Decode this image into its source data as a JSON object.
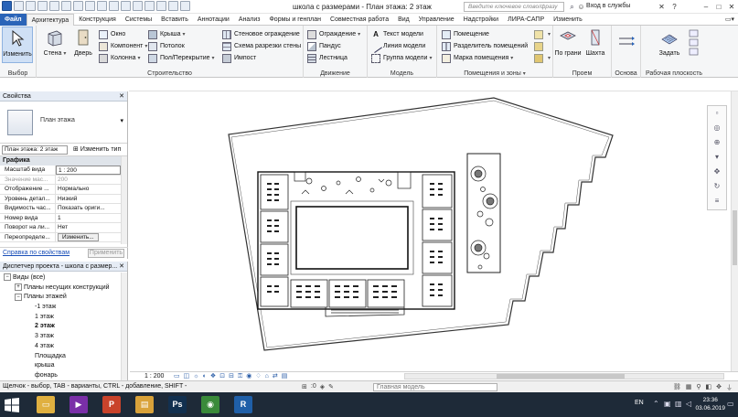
{
  "window": {
    "title": "школа с размерами - План этажа: 2 этаж",
    "search_placeholder": "Введите ключевое слово/фразу",
    "login_label": "Вход в службы",
    "controls": [
      "–",
      "□",
      "✕"
    ]
  },
  "ribbon_tabs": [
    "Файл",
    "Архитектура",
    "Конструкция",
    "Системы",
    "Вставить",
    "Аннотации",
    "Анализ",
    "Формы и генплан",
    "Совместная работа",
    "Вид",
    "Управление",
    "Надстройки",
    "ЛИРА-САПР",
    "Изменить"
  ],
  "active_tab": "Архитектура",
  "ribbon": {
    "select": {
      "button": "Изменить",
      "group": "Выбор"
    },
    "build": {
      "group": "Строительство",
      "wall": "Стена",
      "door": "Дверь",
      "window": "Окно",
      "component": "Компонент",
      "column": "Колонна",
      "roof": "Крыша",
      "ceiling": "Потолок",
      "floor": "Пол/Перекрытие",
      "curtain_system": "Стеновое ограждение",
      "curtain_grid": "Схема разрезки стены",
      "mullion": "Импост"
    },
    "circulation": {
      "group": "Движение",
      "railing": "Ограждение",
      "ramp": "Пандус",
      "stair": "Лестница"
    },
    "model": {
      "group": "Модель",
      "model_text": "Текст модели",
      "model_line": "Линия модели",
      "model_group": "Группа модели"
    },
    "room_area": {
      "group": "Помещения и зоны",
      "room": "Помещение",
      "room_separator": "Разделитель помещений",
      "room_tag": "Марка помещения"
    },
    "opening": {
      "group": "Проем",
      "by_face": "По грани",
      "shaft": "Шахта"
    },
    "datum": {
      "group": "Основа"
    },
    "work_plane": {
      "group": "Рабочая плоскость",
      "set": "Задать"
    }
  },
  "properties": {
    "title": "Свойства",
    "type_name": "План этажа",
    "instance_selector": "План этажа: 2 этаж",
    "edit_type": "Изменить тип",
    "category": "Графика",
    "rows": [
      {
        "key": "Масштаб вида",
        "value": "1 : 200"
      },
      {
        "key": "Значение мас...",
        "value": "200"
      },
      {
        "key": "Отображение ...",
        "value": "Нормально"
      },
      {
        "key": "Уровень детал...",
        "value": "Низкий"
      },
      {
        "key": "Видимость час...",
        "value": "Показать ориги..."
      },
      {
        "key": "Номер вида",
        "value": "1"
      },
      {
        "key": "Поворот на ли...",
        "value": "Нет"
      },
      {
        "key": "Переопределе...",
        "value": "Изменить..."
      }
    ],
    "help_link": "Справка по свойствам",
    "apply": "Применить"
  },
  "project_browser": {
    "title": "Диспетчер проекта - школа с размер...",
    "nodes": [
      {
        "label": "Виды (все)",
        "level": 0,
        "toggle": "−",
        "bold": false
      },
      {
        "label": "Планы несущих конструкций",
        "level": 1,
        "toggle": "+",
        "bold": false
      },
      {
        "label": "Планы этажей",
        "level": 1,
        "toggle": "−",
        "bold": false
      },
      {
        "label": "-1 этаж",
        "level": 2,
        "toggle": "",
        "bold": false
      },
      {
        "label": "1 этаж",
        "level": 2,
        "toggle": "",
        "bold": false
      },
      {
        "label": "2 этаж",
        "level": 2,
        "toggle": "",
        "bold": true
      },
      {
        "label": "3 этаж",
        "level": 2,
        "toggle": "",
        "bold": false
      },
      {
        "label": "4 этаж",
        "level": 2,
        "toggle": "",
        "bold": false
      },
      {
        "label": "Площадка",
        "level": 2,
        "toggle": "",
        "bold": false
      },
      {
        "label": "крыша",
        "level": 2,
        "toggle": "",
        "bold": false
      },
      {
        "label": "фонарь",
        "level": 2,
        "toggle": "",
        "bold": false
      }
    ]
  },
  "view_bar": {
    "scale": "1 : 200"
  },
  "status": {
    "hint": "Щелчок - выбор, TAB - варианты, CTRL - добавление, SHIFT -",
    "workset": "Главная модель",
    "filter_count": ":0"
  },
  "taskbar": {
    "lang": "EN",
    "time": "23:36",
    "date": "03.06.2019",
    "apps": [
      {
        "name": "explorer",
        "color": "#e0b040",
        "glyph": "▭"
      },
      {
        "name": "media-player",
        "color": "#7a2fa8",
        "glyph": "▶"
      },
      {
        "name": "powerpoint",
        "color": "#c9432b",
        "glyph": "P"
      },
      {
        "name": "files",
        "color": "#d9a23a",
        "glyph": "▤"
      },
      {
        "name": "photoshop",
        "color": "#12304f",
        "glyph": "Ps"
      },
      {
        "name": "chrome",
        "color": "#3a8a3a",
        "glyph": "◉"
      },
      {
        "name": "revit",
        "color": "#1f5fa8",
        "glyph": "R"
      }
    ]
  }
}
